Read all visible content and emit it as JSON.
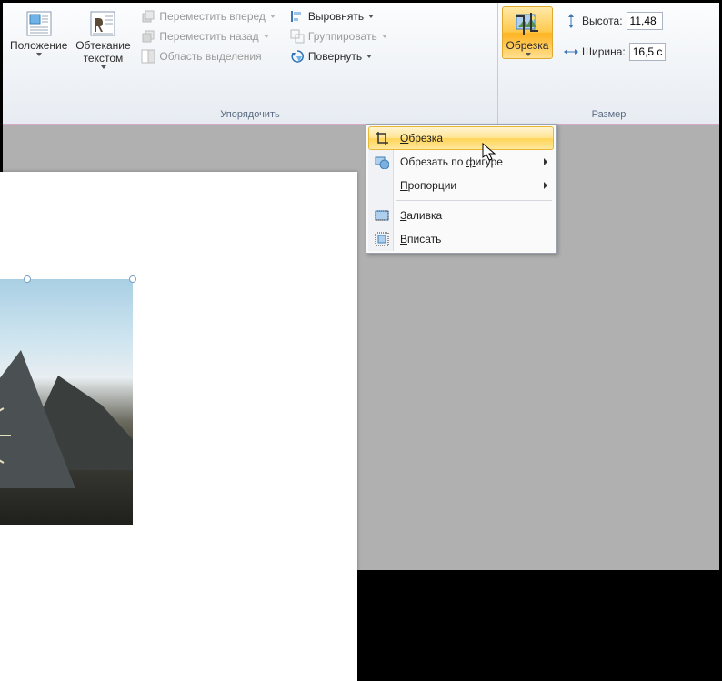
{
  "ribbon": {
    "arrange_group_label": "Упорядочить",
    "size_group_label": "Размер",
    "position_label": "Положение",
    "wrap_label": "Обтекание\nтекстом",
    "bring_forward": "Переместить вперед",
    "send_backward": "Переместить назад",
    "selection_pane": "Область выделения",
    "align": "Выровнять",
    "group_btn": "Группировать",
    "rotate": "Повернуть",
    "crop": "Обрезка",
    "height_label": "Высота:",
    "width_label": "Ширина:",
    "height_value": "11,48",
    "width_value": "16,5 с"
  },
  "menu": {
    "crop": "Обрезка",
    "crop_shape": "Обрезать по фигуре",
    "proportions": "Пропорции",
    "fill": "Заливка",
    "fit": "Вписать"
  }
}
